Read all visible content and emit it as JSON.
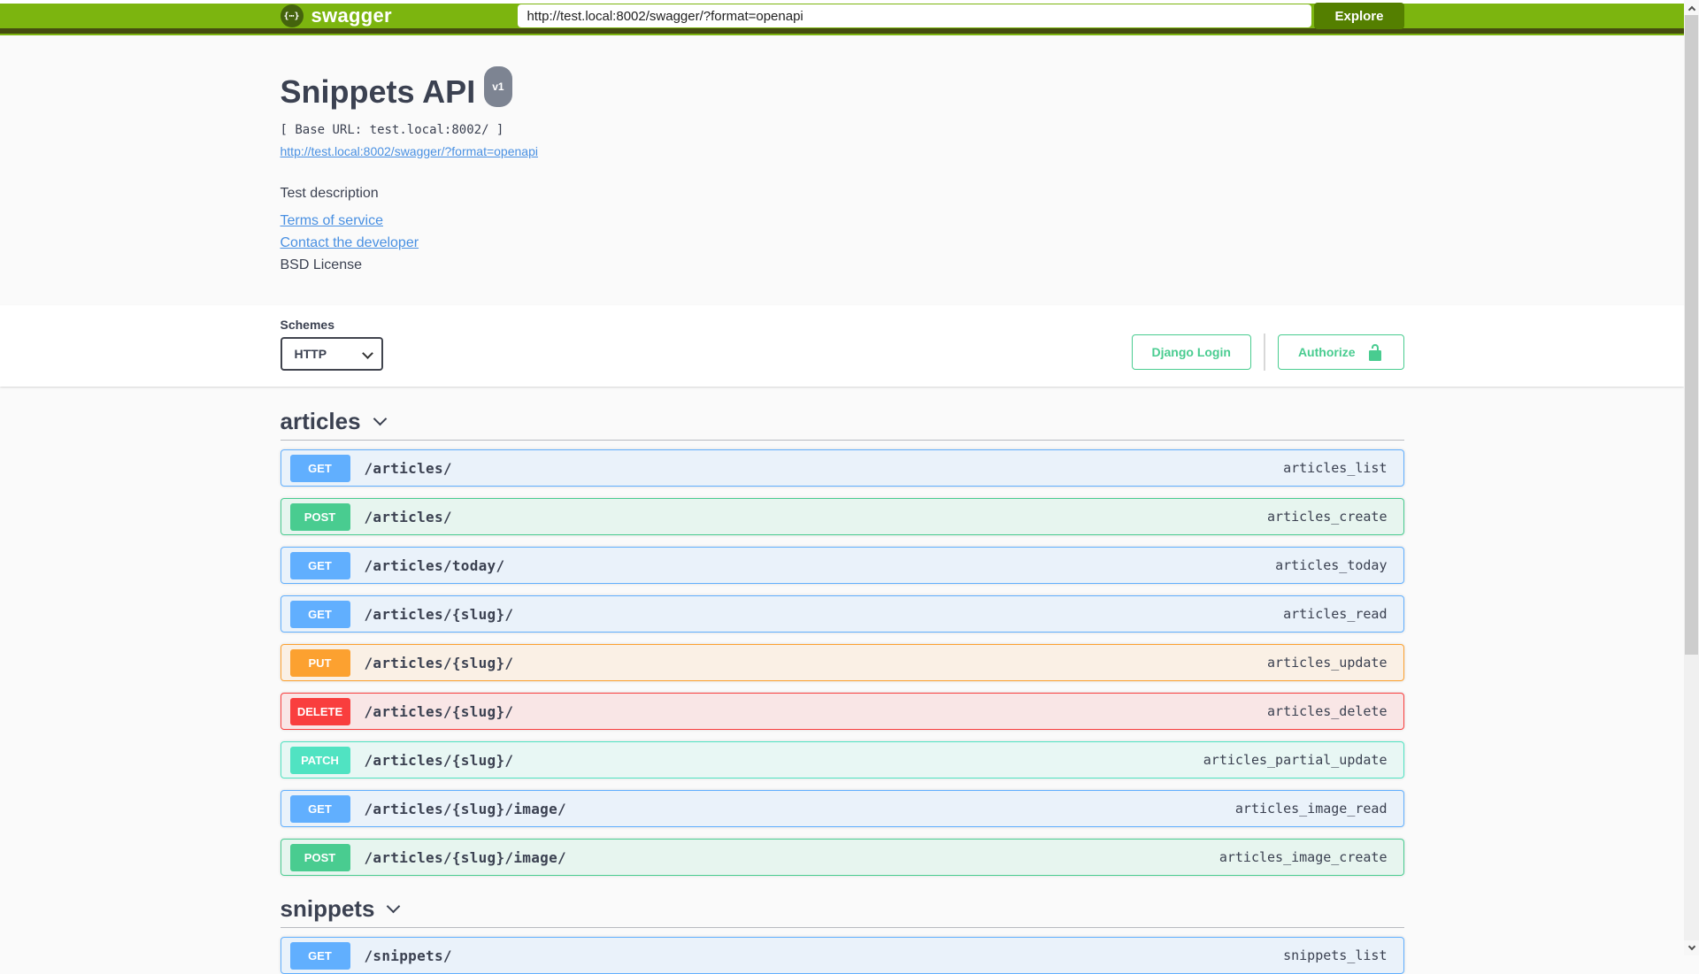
{
  "colors": {
    "topbar": "#7cb50f",
    "topbar_border": "#454d10",
    "explore": "#547f00",
    "logo_circle": "#44630d",
    "accent_green": "#49cc90",
    "link_blue": "#4990e2",
    "text_dark": "#3b4151",
    "page_bg": "#fafafa"
  },
  "topbar": {
    "logo_text": "swagger",
    "logo_glyph": "{⋯}",
    "url_value": "http://test.local:8002/swagger/?format=openapi",
    "explore_label": "Explore"
  },
  "info": {
    "title": "Snippets API",
    "version_badge": "v1",
    "base_url_line": "[ Base URL: test.local:8002/ ]",
    "spec_link": "http://test.local:8002/swagger/?format=openapi",
    "description": "Test description",
    "links": [
      {
        "label": "Terms of service"
      },
      {
        "label": "Contact the developer"
      }
    ],
    "license": "BSD License"
  },
  "schemes": {
    "label": "Schemes",
    "selected": "HTTP"
  },
  "auth": {
    "django_login_label": "Django Login",
    "authorize_label": "Authorize"
  },
  "method_colors": {
    "GET": "#61affe",
    "POST": "#49cc90",
    "PUT": "#fca130",
    "DELETE": "#f93e3e",
    "PATCH": "#50e3c2"
  },
  "method_bg": {
    "GET": "rgba(97,175,254,.1)",
    "POST": "rgba(73,204,144,.1)",
    "PUT": "rgba(252,161,48,.1)",
    "DELETE": "rgba(249,62,62,.1)",
    "PATCH": "rgba(80,227,194,.1)"
  },
  "sections": [
    {
      "name": "articles",
      "operations": [
        {
          "method": "GET",
          "path": "/articles/",
          "operation_id": "articles_list"
        },
        {
          "method": "POST",
          "path": "/articles/",
          "operation_id": "articles_create"
        },
        {
          "method": "GET",
          "path": "/articles/today/",
          "operation_id": "articles_today"
        },
        {
          "method": "GET",
          "path": "/articles/{slug}/",
          "operation_id": "articles_read"
        },
        {
          "method": "PUT",
          "path": "/articles/{slug}/",
          "operation_id": "articles_update"
        },
        {
          "method": "DELETE",
          "path": "/articles/{slug}/",
          "operation_id": "articles_delete"
        },
        {
          "method": "PATCH",
          "path": "/articles/{slug}/",
          "operation_id": "articles_partial_update"
        },
        {
          "method": "GET",
          "path": "/articles/{slug}/image/",
          "operation_id": "articles_image_read"
        },
        {
          "method": "POST",
          "path": "/articles/{slug}/image/",
          "operation_id": "articles_image_create"
        }
      ]
    },
    {
      "name": "snippets",
      "operations": [
        {
          "method": "GET",
          "path": "/snippets/",
          "operation_id": "snippets_list"
        }
      ]
    }
  ]
}
